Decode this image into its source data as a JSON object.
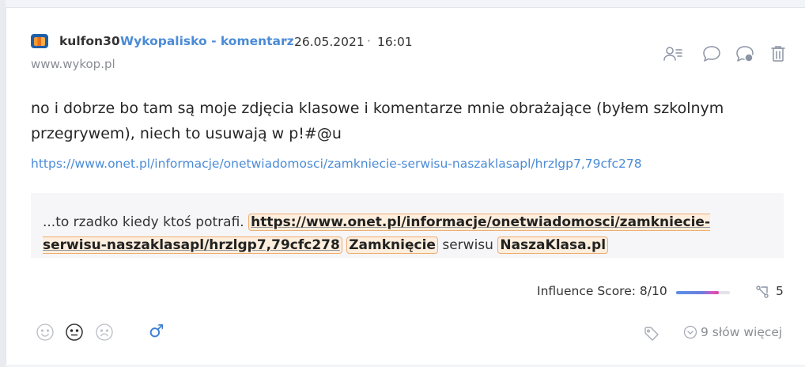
{
  "post": {
    "author": "kulfon30",
    "category": "Wykopalisko - komentarz",
    "separator": "·",
    "date": "26.05.2021",
    "time": "16:01",
    "domain": "www.wykop.pl",
    "text": "no i dobrze bo tam są moje zdjęcia klasowe i komentarze mnie obrażające (byłem szkolnym przegrywem), niech to usuwają w p!#@u",
    "link": "https://www.onet.pl/informacje/onetwiadomosci/zamkniecie-serwisu-naszaklasapl/hrzlgp7,79cfc278"
  },
  "quote": {
    "prefix": "...to rzadko kiedy ktoś potrafi.",
    "link": "https://www.onet.pl/informacje/onetwiadomosci/zamkniecie-serwisu-naszaklasapl/hrzlgp7,79cfc278",
    "highlight1": "Zamknięcie",
    "middle": "serwisu",
    "highlight2": "NaszaKlasa.pl"
  },
  "actions": {
    "icons": [
      "author-info-icon",
      "comment-icon",
      "reply-icon",
      "trash-icon"
    ]
  },
  "influence": {
    "label": "Influence Score: 8/10",
    "score": 8,
    "max": 10,
    "shares": "5"
  },
  "footer": {
    "more_label": "9 słów więcej",
    "gender_symbol": "♂"
  },
  "colors": {
    "accent": "#4b8bd6",
    "highlight_border": "#f0ad72",
    "highlight_bg": "#fdeedd"
  }
}
